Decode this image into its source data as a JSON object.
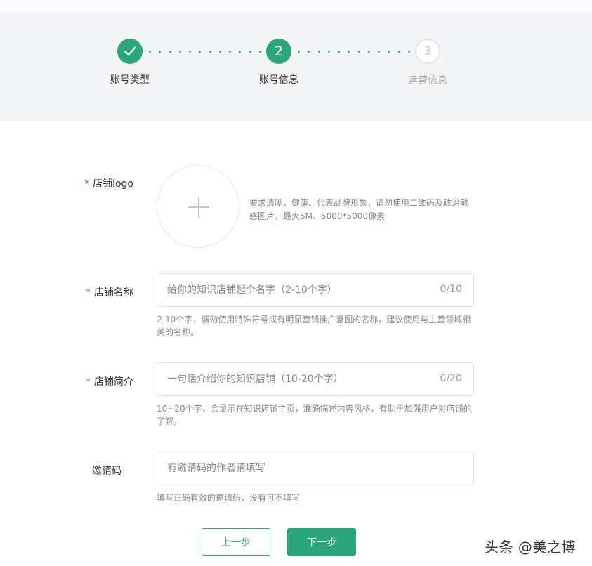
{
  "steps": [
    {
      "label": "账号类型",
      "state": "done",
      "icon": "check-icon"
    },
    {
      "label": "账号信息",
      "number": "2",
      "state": "active"
    },
    {
      "label": "运营信息",
      "number": "3",
      "state": "todo"
    }
  ],
  "form": {
    "logo": {
      "label": "店铺logo",
      "required": "*",
      "hint": "要求清晰、健康、代表品牌形象，请勿使用二维码及政治敏感图片，最大5M、5000*5000像素",
      "icon": "plus-icon"
    },
    "name": {
      "label": "店铺名称",
      "required": "*",
      "placeholder": "给你的知识店铺起个名字（2-10个字）",
      "value": "",
      "counter": "0/10",
      "hint": "2-10个字，请勿使用特殊符号或有明显营销推广意图的名称，建议使用与主营领域相关的名称。"
    },
    "intro": {
      "label": "店铺简介",
      "required": "*",
      "placeholder": "一句话介绍你的知识店铺（10-20个字）",
      "value": "",
      "counter": "0/20",
      "hint": "10~20个字，会显示在知识店铺主页，准确描述内容风格，有助于加强用户对店铺的了解。"
    },
    "invite": {
      "label": "邀请码",
      "placeholder": "有邀请码的作者请填写",
      "value": "",
      "hint": "填写正确有效的邀请码，没有可不填写"
    }
  },
  "buttons": {
    "prev": "上一步",
    "next": "下一步"
  },
  "watermark": "头条 @美之博",
  "colors": {
    "accent": "#2aa57c",
    "required": "#e25a45",
    "stepper_bg": "#f3f4f6"
  }
}
